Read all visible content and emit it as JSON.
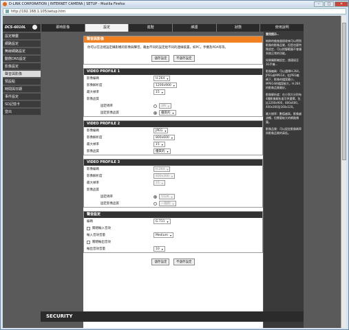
{
  "window": {
    "title": "D-LINK CORPORATION | INTERNET CAMERA | SETUP - Mozilla Firefox",
    "url": "http://192.168.1.105/setup.htm"
  },
  "brand": "DCS-6010L",
  "topnav": [
    "即時影像",
    "設定",
    "進階",
    "維護",
    "狀態",
    "使用說明"
  ],
  "leftnav": [
    "設定精靈",
    "網路設定",
    "無線網路設定",
    "動態DNS設定",
    "影像設定",
    "聲音與影像",
    "預設點",
    "時間與日期",
    "事件設定",
    "SD記憶卡",
    "登出"
  ],
  "main": {
    "title": "聲音與影像",
    "intro": "你可以在這裡設定攝影機的影像與聲音，藉由不同的設定給不同的連線裝置，如PC，手機及PDA等等。",
    "save": "儲存設定",
    "nosave": "不儲存設定"
  },
  "profile1": {
    "title": "VIDEO PROFILE 1",
    "rows": [
      {
        "label": "影像編碼",
        "value": "H.264"
      },
      {
        "label": "影像解析度",
        "value": "1200x900"
      },
      {
        "label": "最大幀率",
        "value": "15"
      },
      {
        "label": "影像品質",
        "value": ""
      }
    ],
    "sub": [
      {
        "label": "固定碼率",
        "value": "2M",
        "selected": false
      },
      {
        "label": "固定影像品質",
        "value": "優質的",
        "selected": true
      }
    ]
  },
  "profile2": {
    "title": "VIDEO PROFILE 2",
    "rows": [
      {
        "label": "影像編碼",
        "value": "JPEG"
      },
      {
        "label": "影像解析度",
        "value": "800x600"
      },
      {
        "label": "最大幀率",
        "value": "15"
      },
      {
        "label": "影像品質",
        "value": "優質的"
      }
    ]
  },
  "profile3": {
    "title": "VIDEO PROFILE 3",
    "rows": [
      {
        "label": "影像編碼",
        "value": "H.264"
      },
      {
        "label": "影像解析度",
        "value": "400x300"
      },
      {
        "label": "最大幀率",
        "value": "15"
      },
      {
        "label": "影像品質",
        "value": ""
      }
    ],
    "sub": [
      {
        "label": "固定碼率",
        "value": "512K",
        "selected": true
      },
      {
        "label": "固定影像品質",
        "value": "一般的",
        "selected": false
      }
    ]
  },
  "audio": {
    "title": "聲音設定",
    "codec_label": "編碼",
    "codec": "G.711",
    "in_mute": "關閉輸入音效",
    "in_vol_label": "輸入音效音量",
    "in_vol": "Medium",
    "out_mute": "關閉輸出音效",
    "out_vol_label": "輸出音效音量",
    "out_vol": "10"
  },
  "sidebar_info": {
    "title": "實用提示..",
    "paragraphs": [
      "純粹的檢查器接收來可以得到影像的影像品質，但是也要特殊設定，可以把握範圍不會讓系統正常的功能。",
      "如果攝影機設定，請連接至3G手機...",
      "影像編碼：可以選擇H.264，JPEG或MPEG4，在JPEG編碼下，影像的檔案最小，MPEG4的檔案較大，H.264的影像品質最好。",
      "影像解析度：在小到大分別有4種影像解析度可供選擇，包括1200x900，800x600，400x300及160x120。",
      "最大幀率：數值越高，影像越流暢，但需要較大的網路頻寬。",
      "影像品質：可以設定影像碼率與影像品質的高低。"
    ]
  },
  "footer": "SECURITY"
}
